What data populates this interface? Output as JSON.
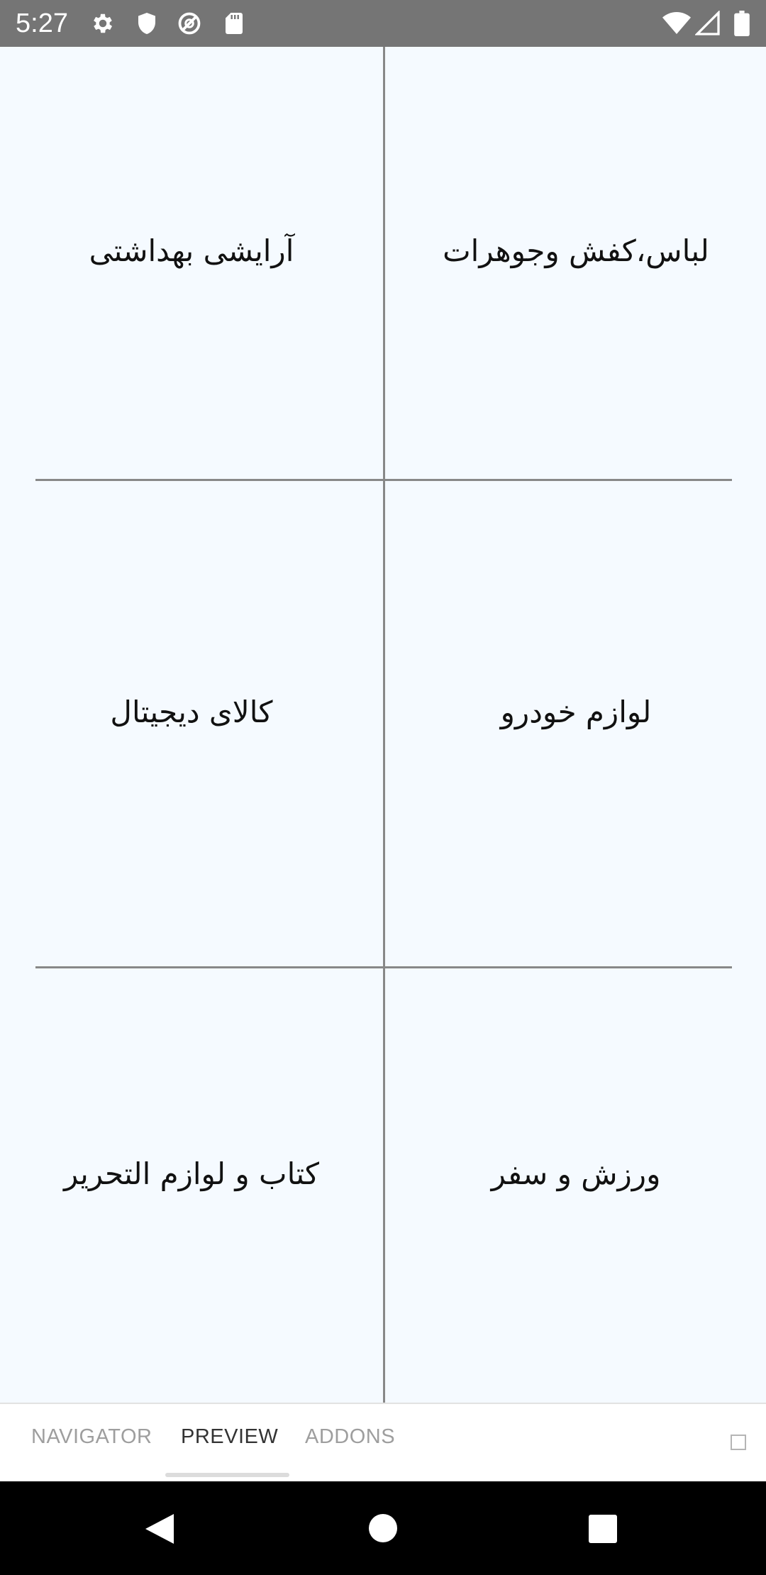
{
  "status_bar": {
    "time": "5:27",
    "left_icons": [
      "gear-icon",
      "shield-icon",
      "at-sign-icon",
      "sd-card-icon"
    ],
    "right_icons": [
      "wifi-icon",
      "signal-icon",
      "battery-icon"
    ]
  },
  "categories": [
    {
      "label": "لباس،کفش وجوهرات"
    },
    {
      "label": "آرایشی بهداشتی"
    },
    {
      "label": "لوازم خودرو"
    },
    {
      "label": "کالای دیجیتال"
    },
    {
      "label": "ورزش و سفر"
    },
    {
      "label": "کتاب و لوازم التحریر"
    }
  ],
  "tabs": [
    {
      "label": "NAVIGATOR"
    },
    {
      "label": "PREVIEW"
    },
    {
      "label": "ADDONS"
    }
  ],
  "active_tab": "PREVIEW",
  "nav": [
    "back-icon",
    "home-icon",
    "recents-icon"
  ]
}
